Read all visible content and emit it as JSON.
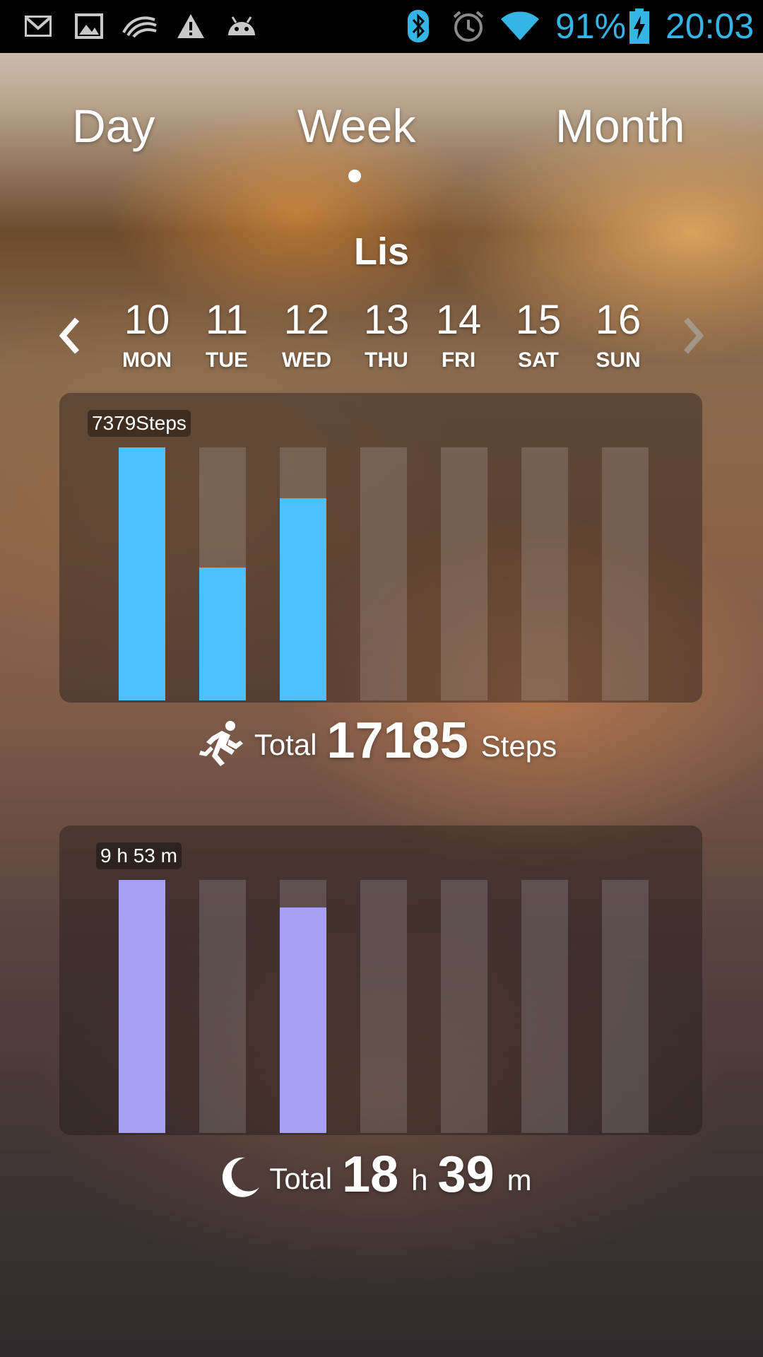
{
  "status_bar": {
    "battery": "91%",
    "time": "20:03",
    "icons": [
      "gmail-icon",
      "gallery-icon",
      "swiftkey-icon",
      "warning-icon",
      "android-icon",
      "bluetooth-icon",
      "alarm-icon",
      "wifi-icon",
      "battery-charging-icon"
    ]
  },
  "tabs": {
    "day": "Day",
    "week": "Week",
    "month": "Month",
    "active": "Week"
  },
  "user_name": "Lis",
  "week": {
    "days": [
      {
        "num": "10",
        "name": "MON"
      },
      {
        "num": "11",
        "name": "TUE"
      },
      {
        "num": "12",
        "name": "WED"
      },
      {
        "num": "13",
        "name": "THU"
      },
      {
        "num": "14",
        "name": "FRI"
      },
      {
        "num": "15",
        "name": "SAT"
      },
      {
        "num": "16",
        "name": "SUN"
      }
    ],
    "prev_icon": "chevron-left-icon",
    "next_icon": "chevron-right-icon"
  },
  "steps_chart": {
    "max_label": "7379Steps",
    "fill_color": "#4dc1ff",
    "levels": [
      1.0,
      0.525,
      0.8,
      0,
      0,
      0,
      0
    ]
  },
  "steps_total": {
    "icon": "running-icon",
    "label": "Total",
    "value": "17185",
    "unit": "Steps"
  },
  "sleep_chart": {
    "max_label": "9 h 53 m",
    "fill_color": "#a8a0f4",
    "levels": [
      1.0,
      0,
      0.89,
      0,
      0,
      0,
      0
    ]
  },
  "sleep_total": {
    "icon": "moon-icon",
    "label": "Total",
    "hours": "18",
    "h": "h",
    "minutes": "39",
    "m": "m"
  }
}
